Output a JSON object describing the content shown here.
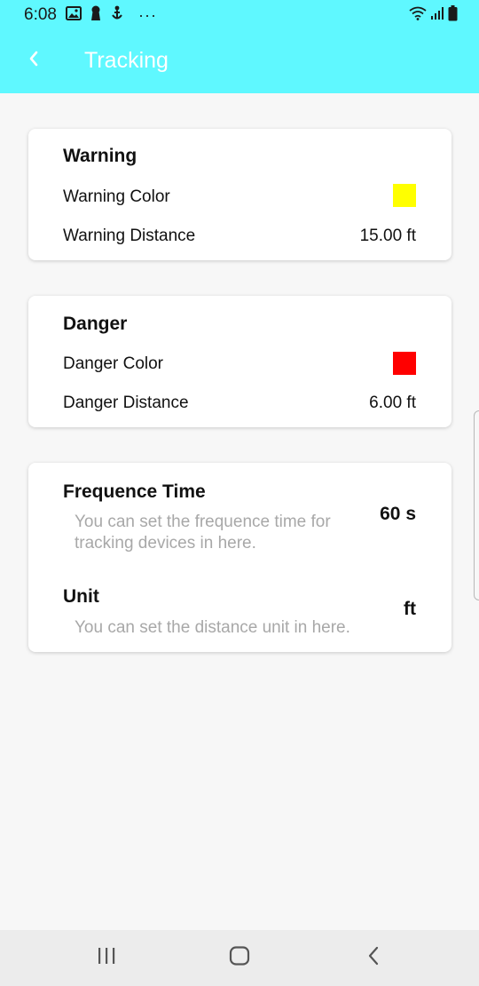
{
  "status_bar": {
    "time": "6:08",
    "left_icons": [
      "image-icon",
      "keyhole-icon",
      "anchor-person-icon"
    ],
    "more": "···",
    "right_icons": [
      "wifi-icon",
      "signal-icon",
      "battery-icon"
    ]
  },
  "app_bar": {
    "back_icon": "back-arrow-icon",
    "title": "Tracking",
    "background_color": "#5ff8ff",
    "title_color": "#ffffff"
  },
  "warning": {
    "title": "Warning",
    "color_label": "Warning Color",
    "color_value": "#ffff00",
    "distance_label": "Warning Distance",
    "distance_value": "15.00 ft"
  },
  "danger": {
    "title": "Danger",
    "color_label": "Danger Color",
    "color_value": "#ff0000",
    "distance_label": "Danger Distance",
    "distance_value": "6.00 ft"
  },
  "settings": {
    "frequence": {
      "title": "Frequence Time",
      "description": "You can set the frequence time for tracking devices in here.",
      "value": "60 s"
    },
    "unit": {
      "title": "Unit",
      "description": "You can set the distance unit in here.",
      "value": "ft"
    }
  },
  "nav_bar": {
    "recents_icon": "recents-icon",
    "home_icon": "home-icon",
    "back_icon": "nav-back-icon"
  }
}
